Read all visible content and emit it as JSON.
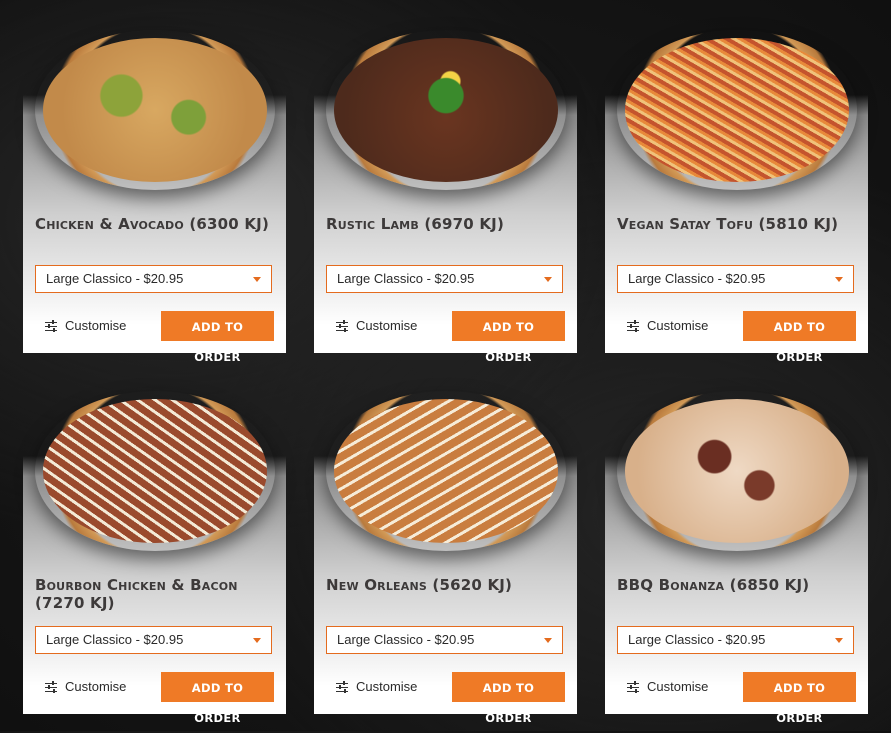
{
  "products": [
    {
      "name": "Chicken & Avocado (6300 KJ)",
      "size_option": "Large Classico - $20.95",
      "customise_label": "Customise",
      "add_label": "ADD TO ORDER"
    },
    {
      "name": "Rustic Lamb (6970 KJ)",
      "size_option": "Large Classico - $20.95",
      "customise_label": "Customise",
      "add_label": "ADD TO ORDER"
    },
    {
      "name": "Vegan Satay Tofu (5810 KJ)",
      "size_option": "Large Classico - $20.95",
      "customise_label": "Customise",
      "add_label": "ADD TO ORDER"
    },
    {
      "name": "Bourbon Chicken & Bacon (7270 KJ)",
      "size_option": "Large Classico - $20.95",
      "customise_label": "Customise",
      "add_label": "ADD TO ORDER"
    },
    {
      "name": "New Orleans (5620 KJ)",
      "size_option": "Large Classico - $20.95",
      "customise_label": "Customise",
      "add_label": "ADD TO ORDER"
    },
    {
      "name": "BBQ Bonanza (6850 KJ)",
      "size_option": "Large Classico - $20.95",
      "customise_label": "Customise",
      "add_label": "ADD TO ORDER"
    }
  ],
  "colors": {
    "accent": "#ef7a26",
    "select_border": "#e46b1e",
    "title_text": "#3d3a3a",
    "page_bg": "#141414"
  }
}
